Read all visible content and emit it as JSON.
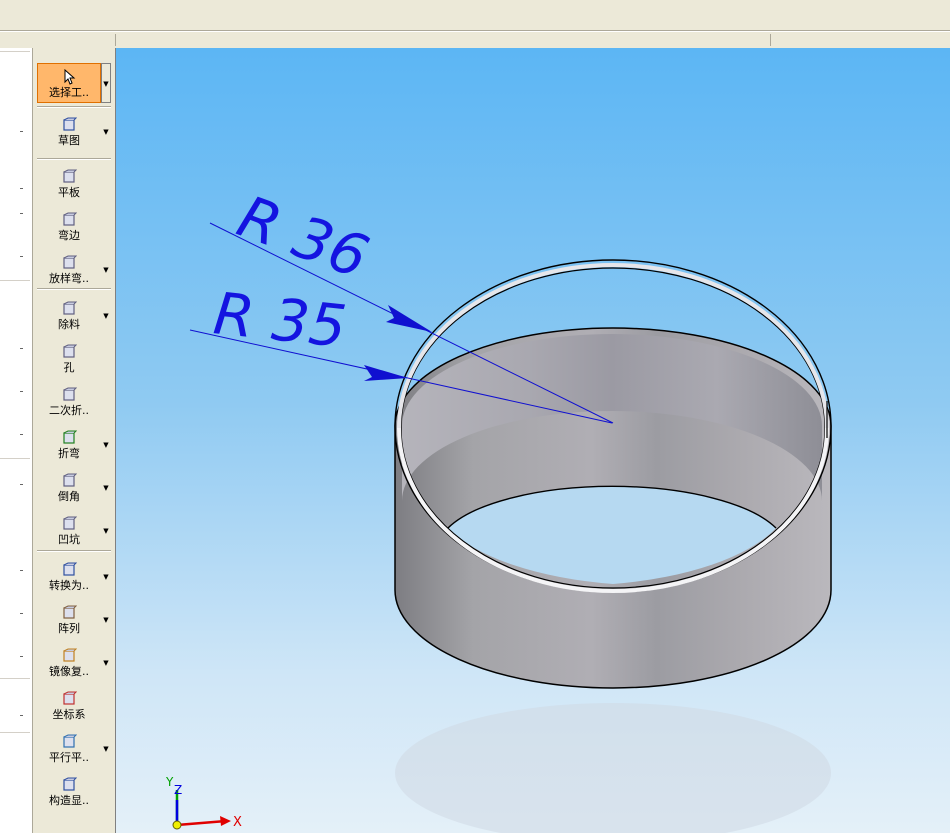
{
  "toolbar": {
    "items": [
      {
        "label": "选择工..",
        "icon": "select-arrow-icon"
      },
      {
        "label": "草图",
        "icon": "sketch-icon"
      },
      {
        "label": "平板",
        "icon": "flat-plate-icon"
      },
      {
        "label": "弯边",
        "icon": "flange-icon"
      },
      {
        "label": "放样弯..",
        "icon": "lofted-bend-icon"
      },
      {
        "label": "除料",
        "icon": "cut-icon"
      },
      {
        "label": "孔",
        "icon": "hole-icon"
      },
      {
        "label": "二次折..",
        "icon": "jog-icon"
      },
      {
        "label": "折弯",
        "icon": "bend-icon"
      },
      {
        "label": "倒角",
        "icon": "chamfer-icon"
      },
      {
        "label": "凹坑",
        "icon": "dimple-icon"
      },
      {
        "label": "转换为..",
        "icon": "convert-icon"
      },
      {
        "label": "阵列",
        "icon": "pattern-icon"
      },
      {
        "label": "镜像复..",
        "icon": "mirror-icon"
      },
      {
        "label": "坐标系",
        "icon": "coordinate-system-icon"
      },
      {
        "label": "平行平..",
        "icon": "parallel-plane-icon"
      },
      {
        "label": "构造显..",
        "icon": "construction-display-icon"
      }
    ]
  },
  "viewport": {
    "dimensions": [
      {
        "label": "R 36"
      },
      {
        "label": "R 35"
      }
    ],
    "triad": {
      "y_label": "Y",
      "z_label": "Z",
      "x_label": "X"
    }
  },
  "colors": {
    "dimension": "#0000ff",
    "active_tool": "#ffb76b",
    "background_top": "#5cb6f4",
    "background_bottom": "#e4f0f8",
    "part": "#a8a8b0"
  }
}
